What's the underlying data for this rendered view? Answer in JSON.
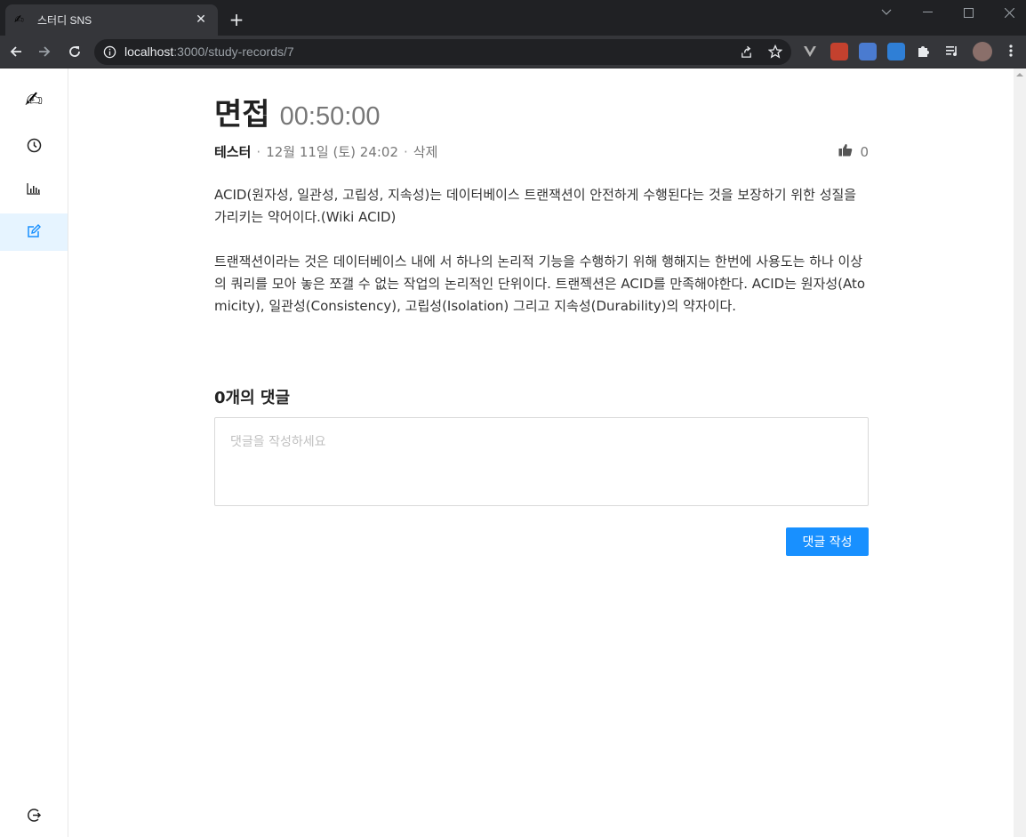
{
  "browser": {
    "tab_title": "스터디 SNS",
    "tab_favicon": "✍",
    "close_glyph": "✕",
    "new_tab_glyph": "+",
    "url_host": "localhost",
    "url_path": ":3000/study-records/7",
    "icons": [
      "back-icon",
      "forward-icon",
      "reload-icon",
      "info-icon",
      "share-icon",
      "star-icon",
      "extensions-icon",
      "menu-icon"
    ]
  },
  "sidebar": {
    "logo": "✍",
    "items": [
      {
        "name": "clock-icon"
      },
      {
        "name": "bar-chart-icon"
      },
      {
        "name": "edit-icon",
        "active": true
      }
    ],
    "logout": "logout-icon"
  },
  "post": {
    "title": "면접",
    "duration": "00:50:00",
    "author": "테스터",
    "date": "12월 11일 (토) 24:02",
    "delete_label": "삭제",
    "like_count": "0",
    "paragraphs": [
      "ACID(원자성, 일관성, 고립성, 지속성)는 데이터베이스 트랜잭션이 안전하게 수행된다는 것을 보장하기 위한 성질을 가리키는 약어이다.(Wiki ACID)",
      "트랜잭션이라는 것은 데이터베이스 내에 서 하나의 논리적 기능을 수행하기 위해 행해지는 한번에 사용도는 하나 이상의 쿼리를 모아 놓은 쪼갤 수 없는 작업의 논리적인 단위이다. 트랜젝션은 ACID를 만족해야한다. ACID는 원자성(Atomicity), 일관성(Consistency), 고립성(Isolation) 그리고 지속성(Durability)의 약자이다."
    ]
  },
  "comments": {
    "title": "0개의 댓글",
    "placeholder": "댓글을 작성하세요",
    "submit_label": "댓글 작성"
  },
  "colors": {
    "accent": "#1890ff",
    "active_bg": "#e6f4ff"
  }
}
